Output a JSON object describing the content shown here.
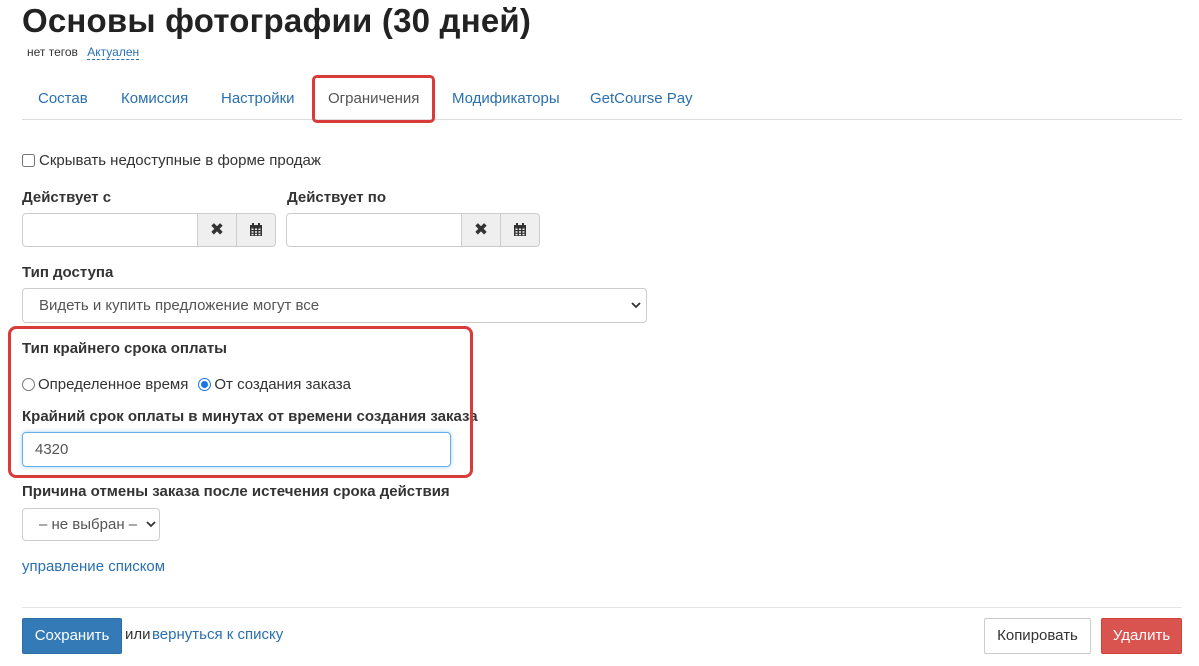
{
  "page": {
    "title": "Основы фотографии (30 дней)",
    "tags_text": "нет тегов",
    "status_link": "Актуален"
  },
  "tabs": [
    {
      "label": "Состав",
      "active": false
    },
    {
      "label": "Комиссия",
      "active": false
    },
    {
      "label": "Настройки",
      "active": false
    },
    {
      "label": "Ограничения",
      "active": true
    },
    {
      "label": "Модификаторы",
      "active": false
    },
    {
      "label": "GetCourse Pay",
      "active": false
    }
  ],
  "form": {
    "hide_unavailable": {
      "label": "Скрывать недоступные в форме продаж",
      "checked": false
    },
    "valid_from": {
      "label": "Действует с",
      "value": ""
    },
    "valid_to": {
      "label": "Действует по",
      "value": ""
    },
    "access_type": {
      "label": "Тип доступа",
      "selected": "Видеть и купить предложение могут все"
    },
    "deadline_type": {
      "label": "Тип крайнего срока оплаты",
      "options": [
        {
          "label": "Определенное время",
          "checked": false
        },
        {
          "label": "От создания заказа",
          "checked": true
        }
      ]
    },
    "deadline_minutes": {
      "label": "Крайний срок оплаты в минутах от времени создания заказа",
      "value": "4320"
    },
    "cancel_reason": {
      "label": "Причина отмены заказа после истечения срока действия",
      "selected": "– не выбран –"
    },
    "manage_list_link": "управление списком"
  },
  "footer": {
    "save_label": "Сохранить",
    "or_text": "или",
    "back_link": "вернуться к списку",
    "copy_label": "Копировать",
    "delete_label": "Удалить"
  },
  "colors": {
    "link": "#2a6fb0",
    "highlight": "#d93a3a",
    "primary": "#337ab7",
    "danger": "#d9534f"
  }
}
